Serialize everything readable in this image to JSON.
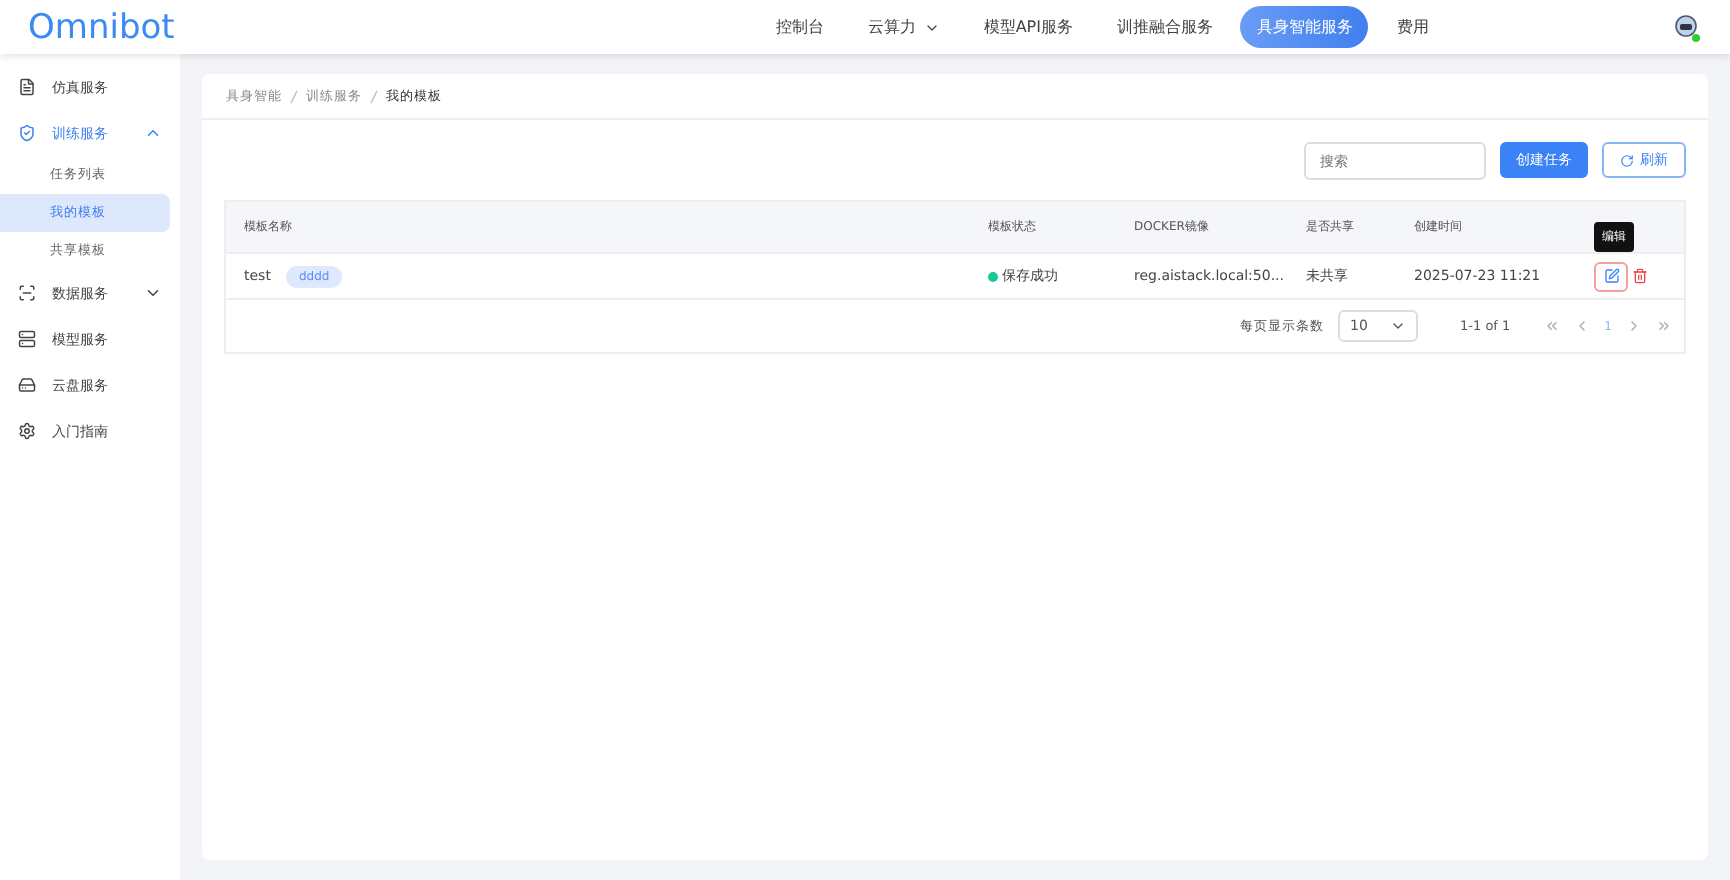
{
  "logo": "Omnibot",
  "nav": [
    {
      "label": "控制台",
      "selected": false,
      "dropdown": false
    },
    {
      "label": "云算力",
      "selected": false,
      "dropdown": true
    },
    {
      "label": "模型API服务",
      "selected": false,
      "dropdown": false
    },
    {
      "label": "训推融合服务",
      "selected": false,
      "dropdown": false
    },
    {
      "label": "具身智能服务",
      "selected": true,
      "dropdown": false
    },
    {
      "label": "费用",
      "selected": false,
      "dropdown": false
    }
  ],
  "sidebar": {
    "items": [
      {
        "label": "仿真服务",
        "selected": false
      },
      {
        "label": "训练服务",
        "selected": true,
        "expanded": true,
        "children": [
          {
            "label": "任务列表",
            "selected": false
          },
          {
            "label": "我的模板",
            "selected": true
          },
          {
            "label": "共享模板",
            "selected": false
          }
        ]
      },
      {
        "label": "数据服务",
        "selected": false,
        "expanded": false
      },
      {
        "label": "模型服务",
        "selected": false
      },
      {
        "label": "云盘服务",
        "selected": false
      },
      {
        "label": "入门指南",
        "selected": false
      }
    ]
  },
  "breadcrumb": [
    "具身智能",
    "训练服务",
    "我的模板"
  ],
  "search": {
    "placeholder": "搜索"
  },
  "buttons": {
    "create": "创建任务",
    "refresh": "刷新"
  },
  "table": {
    "columns": [
      "模板名称",
      "模板状态",
      "DOCKER镜像",
      "是否共享",
      "创建时间"
    ],
    "rows": [
      {
        "name": "test",
        "tag": "dddd",
        "status": "保存成功",
        "color": "#19c79a",
        "image": "reg.aistack.local:50...",
        "shared": "未共享",
        "created": "2025-07-23 11:21"
      }
    ],
    "tooltip": "编辑"
  },
  "pagination": {
    "per_page_label": "每页显示条数",
    "per_page": "10",
    "range": "1-1 of 1",
    "page": "1"
  }
}
